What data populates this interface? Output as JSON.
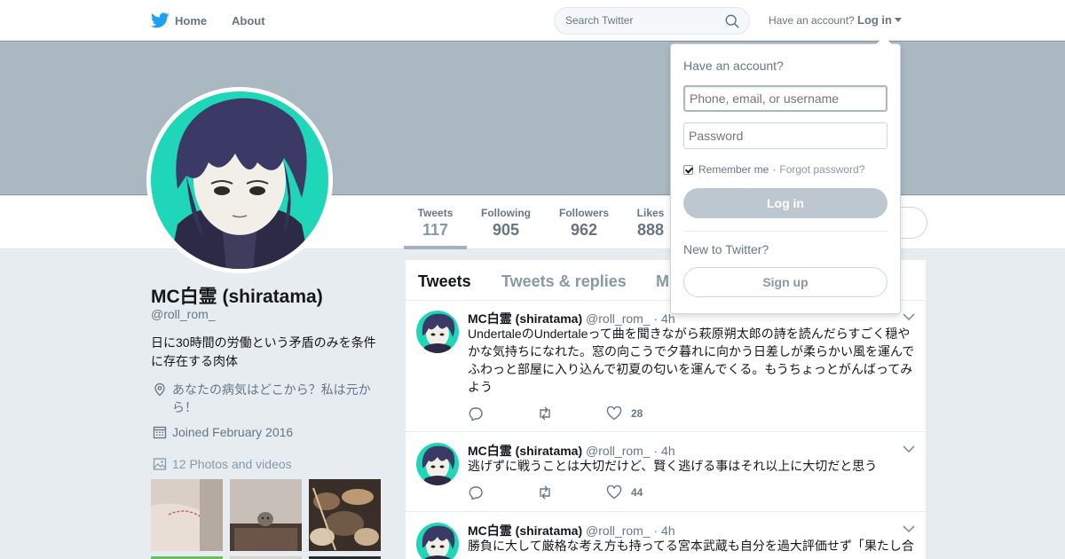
{
  "nav": {
    "home_label": "Home",
    "about_label": "About",
    "search_placeholder": "Search Twitter",
    "have_account": "Have an account?",
    "login_label": "Log in"
  },
  "profile": {
    "name": "MC白霊 (shiratama)",
    "handle": "@roll_rom_",
    "bio": "日に30時間の労働という矛盾のみを条件に存在する肉体",
    "location": "あなたの病気はどこから？私は元から！",
    "joined": "Joined February 2016",
    "photos_label": "12 Photos and videos"
  },
  "stats": [
    {
      "label": "Tweets",
      "value": "117"
    },
    {
      "label": "Following",
      "value": "905"
    },
    {
      "label": "Followers",
      "value": "962"
    },
    {
      "label": "Likes",
      "value": "888"
    }
  ],
  "tabs": [
    "Tweets",
    "Tweets & replies",
    "M"
  ],
  "tweets": [
    {
      "name": "MC白霊 (shiratama)",
      "meta": "@roll_rom_ · 4h",
      "text": "UndertaleのUndertaleって曲を聞きながら萩原朔太郎の詩を読んだらすごく穏やかな気持ちになれた。窓の向こうで夕暮れに向かう日差しが柔らかい風を運んでふわっと部屋に入り込んで初夏の匂いを運んでくる。もうちょっとがんばってみよう",
      "likes": "28"
    },
    {
      "name": "MC白霊 (shiratama)",
      "meta": "@roll_rom_ · 4h",
      "text": "逃げずに戦うことは大切だけど、賢く逃げる事はそれ以上に大切だと思う",
      "likes": "44"
    },
    {
      "name": "MC白霊 (shiratama)",
      "meta": "@roll_rom_ · 4h",
      "text": "勝負に大して厳格な考え方も持ってる宮本武蔵も自分を過大評価せず「果たし合",
      "likes": ""
    }
  ],
  "login": {
    "title": "Have an account?",
    "user_placeholder": "Phone, email, or username",
    "password_placeholder": "Password",
    "remember": "Remember me",
    "sep": "·",
    "forgot": "Forgot password?",
    "button": "Log in",
    "new_label": "New to Twitter?",
    "signup": "Sign up"
  },
  "colors": {
    "banner": "#aab8c2",
    "avatar_bg": "#1fd6b8",
    "twitter_blue": "#1da1f2"
  }
}
